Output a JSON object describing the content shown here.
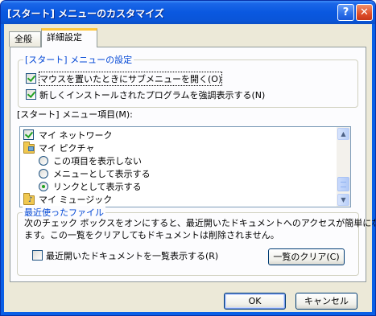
{
  "window": {
    "title": "[スタート] メニューのカスタマイズ",
    "help_glyph": "?",
    "close_glyph": "✕"
  },
  "tabs": [
    {
      "label": "全般",
      "selected": false
    },
    {
      "label": "詳細設定",
      "selected": true
    }
  ],
  "start_menu_settings": {
    "group_label": "[スタート] メニューの設定",
    "options": [
      {
        "label": "マウスを置いたときにサブメニューを開く(O)",
        "checked": true
      },
      {
        "label": "新しくインストールされたプログラムを強調表示する(N)",
        "checked": true
      }
    ]
  },
  "start_menu_items": {
    "label": "[スタート] メニュー項目(M):",
    "items": [
      {
        "text": "マイ ネットワーク",
        "kind": "checkbox",
        "checked": true
      },
      {
        "text": "マイ ピクチャ",
        "kind": "folder"
      },
      {
        "text": "この項目を表示しない",
        "kind": "radio",
        "selected": false
      },
      {
        "text": "メニューとして表示する",
        "kind": "radio",
        "selected": false
      },
      {
        "text": "リンクとして表示する",
        "kind": "radio",
        "selected": true
      },
      {
        "text": "マイ ミュージック",
        "kind": "folder"
      }
    ],
    "scroll_up_glyph": "▲",
    "scroll_down_glyph": "▼"
  },
  "recent_documents": {
    "group_label": "最近使ったファイル",
    "description_line1": "次のチェック ボックスをオンにすると、最近開いたドキュメントへのアクセスが簡単になり",
    "description_line2": "ます。この一覧をクリアしてもドキュメントは削除されません。",
    "list_option_label": "最近開いたドキュメントを一覧表示する(R)",
    "list_option_checked": false,
    "clear_button": "一覧のクリア(C)"
  },
  "footer": {
    "ok_label": "OK",
    "cancel_label": "キャンセル"
  }
}
